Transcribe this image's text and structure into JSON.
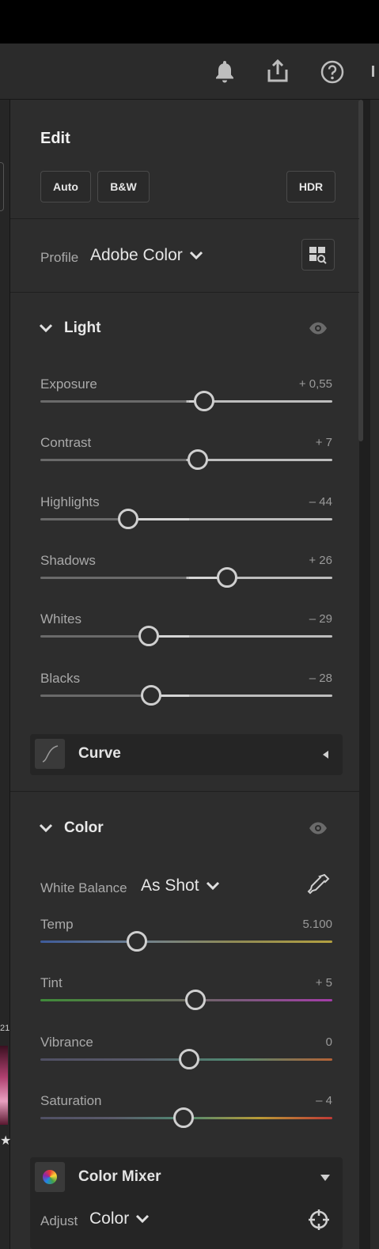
{
  "toolbar": {
    "icons": [
      "bell-icon",
      "share-icon",
      "help-icon"
    ]
  },
  "filmstrip": {
    "badge_text": "21",
    "rating_glyph": "★"
  },
  "edit": {
    "title": "Edit",
    "buttons": {
      "auto": "Auto",
      "bw": "B&W",
      "hdr": "HDR"
    }
  },
  "profile": {
    "label": "Profile",
    "value": "Adobe Color"
  },
  "light": {
    "title": "Light",
    "sliders": [
      {
        "label": "Exposure",
        "value": "+ 0,55",
        "position": 0.56
      },
      {
        "label": "Contrast",
        "value": "+ 7",
        "position": 0.54
      },
      {
        "label": "Highlights",
        "value": "– 44",
        "position": 0.3
      },
      {
        "label": "Shadows",
        "value": "+ 26",
        "position": 0.64
      },
      {
        "label": "Whites",
        "value": "– 29",
        "position": 0.37
      },
      {
        "label": "Blacks",
        "value": "– 28",
        "position": 0.38
      }
    ]
  },
  "curve": {
    "title": "Curve"
  },
  "color": {
    "title": "Color",
    "white_balance": {
      "label": "White Balance",
      "value": "As Shot"
    },
    "sliders": [
      {
        "label": "Temp",
        "value": "5.100",
        "position": 0.33
      },
      {
        "label": "Tint",
        "value": "+ 5",
        "position": 0.53
      },
      {
        "label": "Vibrance",
        "value": "0",
        "position": 0.51
      },
      {
        "label": "Saturation",
        "value": "– 4",
        "position": 0.49
      }
    ]
  },
  "color_mixer": {
    "title": "Color Mixer",
    "adjust_label": "Adjust",
    "adjust_value": "Color"
  },
  "colors": {
    "panel_bg": "#2d2d2d",
    "temp_track": "linear-gradient(90deg,#3e5b9a,#6f8090,#8f8a55,#b3a040)",
    "tint_track": "linear-gradient(90deg,#3f8a3a,#5d7a4a,#7a5a7a,#a43da8)",
    "vibrance_track": "linear-gradient(90deg,#505064,#5a5a6a,#4f8a72,#b46236)",
    "saturation_track": "linear-gradient(90deg,#505064,#5a5a6a,#4f8a72,#b89a36,#c03a36)"
  }
}
